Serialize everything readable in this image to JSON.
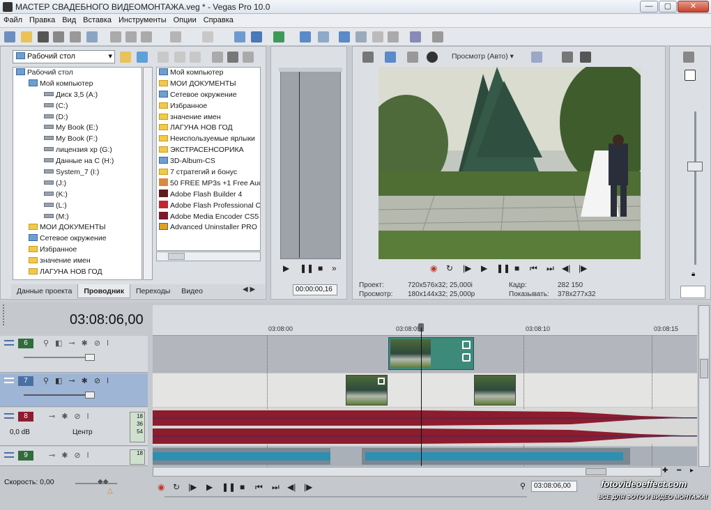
{
  "window": {
    "title": "МАСТЕР СВАДЕБНОГО ВИДЕОМОНТАЖА.veg * - Vegas Pro 10.0",
    "min": "—",
    "max": "▢",
    "close": "✕"
  },
  "menu": [
    "Файл",
    "Правка",
    "Вид",
    "Вставка",
    "Инструменты",
    "Опции",
    "Справка"
  ],
  "explorer": {
    "location": "Рабочий стол",
    "tree": [
      "Рабочий стол",
      "Мой компьютер",
      "Диск 3,5 (A:)",
      "(C:)",
      "(D:)",
      "My Book (E:)",
      "My Book (F:)",
      "лицензия xp (G:)",
      "Данные на C (H:)",
      "System_7 (I:)",
      "(J:)",
      "(K:)",
      "(L:)",
      "(M:)",
      "МОИ ДОКУМЕНТЫ",
      "Сетевое окружение",
      "Избранное",
      "значение имен",
      "ЛАГУНА НОВ ГОД"
    ],
    "files": [
      "Мой компьютер",
      "МОИ ДОКУМЕНТЫ",
      "Сетевое окружение",
      "Избранное",
      "значение имен",
      "ЛАГУНА НОВ ГОД",
      "Неиспользуемые ярлыки",
      "ЭКСТРАСЕНСОРИКА",
      "3D-Album-CS",
      "7 стратегий и бонус",
      "50 FREE MP3s +1 Free Auc",
      "Adobe Flash Builder 4",
      "Adobe Flash Professional C",
      "Adobe Media Encoder CS5",
      "Advanced Uninstaller PRO"
    ],
    "tabs": [
      "Данные проекта",
      "Проводник",
      "Переходы",
      "Видео"
    ]
  },
  "trimmer": {
    "timecode": "00:00:00,16"
  },
  "preview": {
    "mode": "Просмотр (Авто)",
    "project_label": "Проект:",
    "project_value": "720x576x32; 25,000i",
    "preview_label": "Просмотр:",
    "preview_value": "180x144x32; 25,000p",
    "frame_label": "Кадр:",
    "frame_value": "282 150",
    "display_label": "Показывать:",
    "display_value": "378x277x32"
  },
  "timeline": {
    "timecode": "03:08:06,00",
    "ruler": [
      "03:08:00",
      "03:08:05",
      "03:08:10",
      "03:08:15"
    ],
    "tracks": [
      {
        "num": "6",
        "type": "video"
      },
      {
        "num": "7",
        "type": "video"
      },
      {
        "num": "8",
        "type": "audio",
        "vol": "0,0 dB",
        "pan": "Центр",
        "meter": [
          "18",
          "36",
          "54"
        ]
      },
      {
        "num": "9",
        "type": "audio",
        "meter": [
          "18"
        ]
      }
    ],
    "speed": "Скорость: 0,00",
    "bottom_timecode": "03:08:06,00"
  },
  "watermark": {
    "site": "fotovideoeffect.com",
    "tagline": "ВСЕ ДЛЯ ФОТО И ВИДЕО МОНТАЖА!"
  },
  "colors": {
    "video_track": "#7b9cc8",
    "audio_wave": "#8d1c2e",
    "audio_wave2": "#2f8fb0",
    "track_num": "#2f6d3b"
  }
}
